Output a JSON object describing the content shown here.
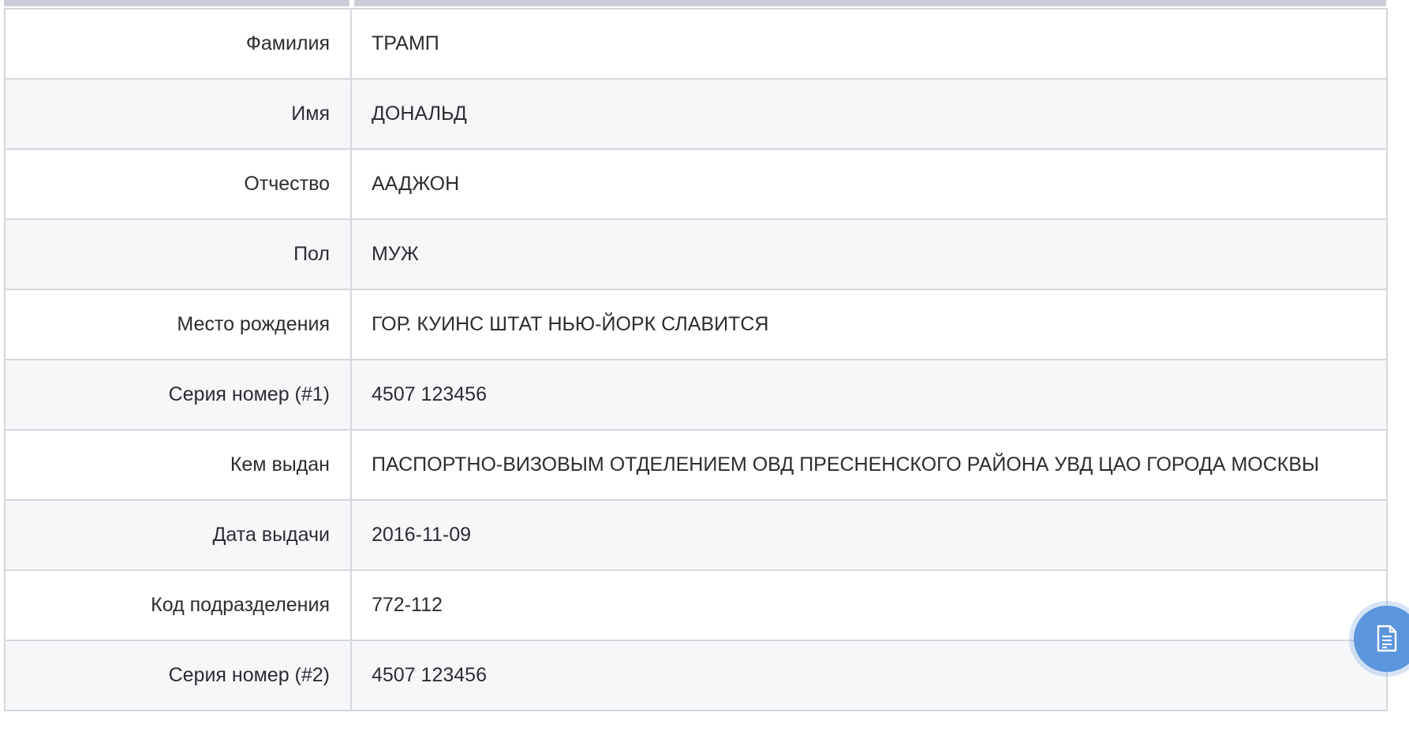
{
  "passport_table": {
    "rows": [
      {
        "label": "Фамилия",
        "value": "ТРАМП"
      },
      {
        "label": "Имя",
        "value": "ДОНАЛЬД"
      },
      {
        "label": "Отчество",
        "value": "ААДЖОН"
      },
      {
        "label": "Пол",
        "value": "МУЖ"
      },
      {
        "label": "Место рождения",
        "value": "ГОР. КУИНС ШТАТ НЬЮ-ЙОРК СЛАВИТСЯ"
      },
      {
        "label": "Серия номер (#1)",
        "value": "4507 123456"
      },
      {
        "label": "Кем выдан",
        "value": "ПАСПОРТНО-ВИЗОВЫМ ОТДЕЛЕНИЕМ ОВД ПРЕСНЕНСКОГО РАЙОНА УВД ЦАО ГОРОДА МОСКВЫ"
      },
      {
        "label": "Дата выдачи",
        "value": "2016-11-09"
      },
      {
        "label": "Код подразделения",
        "value": "772-112"
      },
      {
        "label": "Серия номер (#2)",
        "value": "4507 123456"
      }
    ]
  },
  "floating_button": {
    "icon": "document-icon",
    "color": "#5b95dc"
  }
}
